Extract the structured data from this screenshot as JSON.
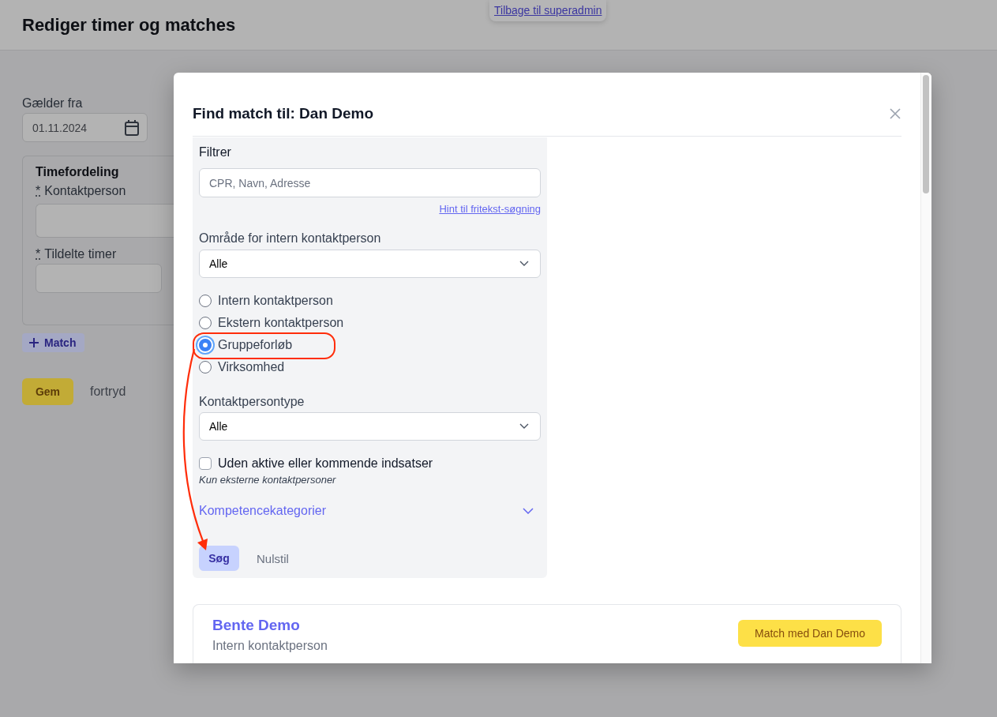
{
  "page": {
    "title": "Rediger timer og matches",
    "back_link": "Tilbage til superadmin"
  },
  "form": {
    "valid_from": {
      "label": "Gælder fra",
      "value": "01.11.2024"
    },
    "allocation": {
      "title": "Timefordeling",
      "fields": [
        {
          "label": "Kontaktperson",
          "required_mark": "*"
        },
        {
          "label": "Tildelte timer",
          "required_mark": "*"
        }
      ]
    },
    "add_match_button": "Match",
    "save_button": "Gem",
    "cancel_link": "fortryd"
  },
  "modal": {
    "title": "Find match til: Dan Demo",
    "filter": {
      "heading": "Filtrer",
      "search": {
        "placeholder": "CPR, Navn, Adresse"
      },
      "hint_link": "Hint til fritekst-søgning",
      "area": {
        "label": "Område for intern kontaktperson",
        "value": "Alle"
      },
      "options": [
        {
          "label": "Intern kontaktperson",
          "selected": false,
          "highlighted": false
        },
        {
          "label": "Ekstern kontaktperson",
          "selected": false,
          "highlighted": false
        },
        {
          "label": "Gruppeforløb",
          "selected": true,
          "highlighted": true
        },
        {
          "label": "Virksomhed",
          "selected": false,
          "highlighted": false
        }
      ],
      "contact_type": {
        "label": "Kontaktpersontype",
        "value": "Alle"
      },
      "without_active": {
        "label": "Uden aktive eller kommende indsatser",
        "checked": false,
        "note": "Kun eksterne kontaktpersoner"
      },
      "competences": {
        "label": "Kompetencekategorier",
        "expanded": false
      },
      "search_button": "Søg",
      "reset_button": "Nulstil",
      "arrow_to_search": true
    },
    "results": [
      {
        "name": "Bente Demo",
        "type": "Intern kontaktperson",
        "action": "Match med Dan Demo"
      }
    ]
  }
}
